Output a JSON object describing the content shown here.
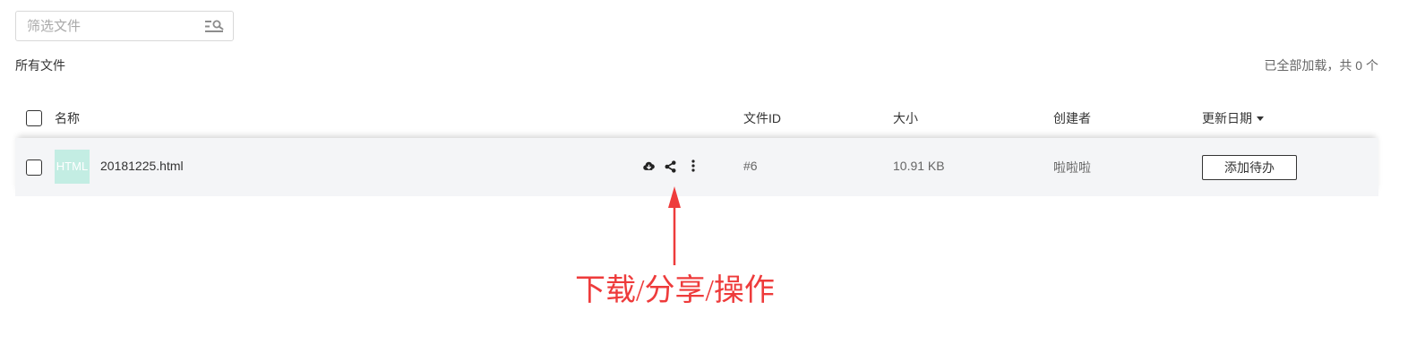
{
  "filter": {
    "placeholder": "筛选文件",
    "icon": "filter-search-icon"
  },
  "breadcrumb": "所有文件",
  "load_status": "已全部加载，共 0 个",
  "columns": {
    "name": "名称",
    "file_id": "文件ID",
    "size": "大小",
    "creator": "创建者",
    "updated": "更新日期",
    "sort_icon": "caret-down-icon"
  },
  "files": [
    {
      "thumb_label": "HTML",
      "name": "20181225.html",
      "file_id": "#6",
      "size": "10.91 KB",
      "creator": "啦啦啦",
      "todo_button": "添加待办",
      "actions": [
        "cloud-download-icon",
        "share-icon",
        "more-vertical-icon"
      ]
    }
  ],
  "annotation": {
    "text": "下载/分享/操作",
    "color": "#ee3b3b"
  },
  "colors": {
    "row_background": "#f4f5f7",
    "thumb_background": "#c3ede3",
    "border": "#d9d9d9"
  }
}
